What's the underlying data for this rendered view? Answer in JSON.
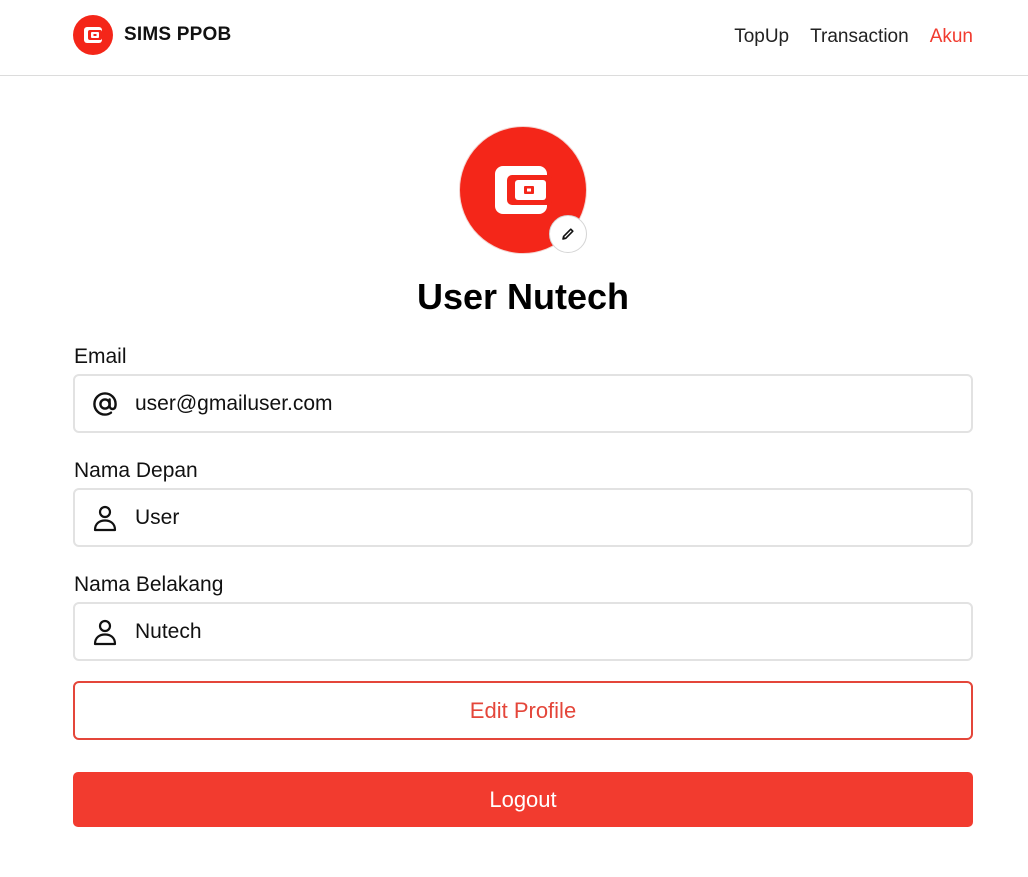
{
  "app": {
    "name": "SIMS PPOB",
    "brand_color": "#f42619",
    "logo_icon": "wallet-icon"
  },
  "nav": {
    "items": [
      {
        "label": "TopUp",
        "active": false
      },
      {
        "label": "Transaction",
        "active": false
      },
      {
        "label": "Akun",
        "active": true
      }
    ],
    "active_color": "#f13b2f"
  },
  "profile": {
    "avatar_icon": "wallet-icon",
    "edit_avatar_icon": "pencil-icon",
    "full_name": "User Nutech"
  },
  "form": {
    "email": {
      "label": "Email",
      "value": "user@gmailuser.com",
      "icon": "at-sign-icon"
    },
    "first_name": {
      "label": "Nama Depan",
      "value": "User",
      "icon": "user-icon"
    },
    "last_name": {
      "label": "Nama Belakang",
      "value": "Nutech",
      "icon": "user-icon"
    }
  },
  "actions": {
    "edit_profile": "Edit Profile",
    "logout": "Logout"
  }
}
